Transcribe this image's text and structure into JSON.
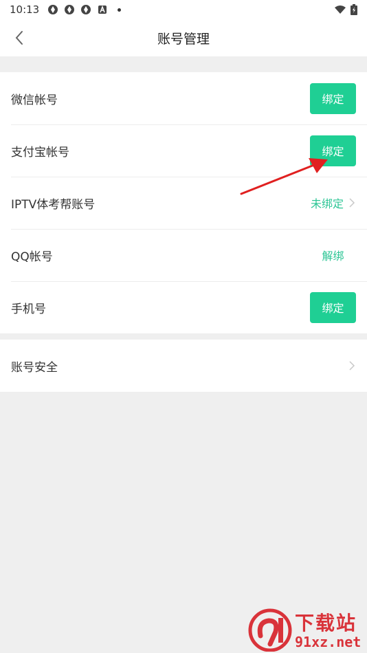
{
  "status_bar": {
    "time": "10:13",
    "icons": [
      "notification-icon",
      "notification-icon",
      "notification-icon",
      "a-icon",
      "dot-icon"
    ],
    "right_icons": [
      "wifi-icon",
      "battery-icon"
    ]
  },
  "header": {
    "title": "账号管理",
    "back_icon": "chevron-left-icon"
  },
  "accounts": [
    {
      "label": "微信帐号",
      "action": "绑定"
    },
    {
      "label": "支付宝帐号",
      "action": "绑定"
    },
    {
      "label": "IPTV体考帮账号",
      "status": "未绑定"
    },
    {
      "label": "QQ帐号",
      "action": "解绑"
    },
    {
      "label": "手机号",
      "action": "绑定"
    }
  ],
  "security": {
    "label": "账号安全"
  },
  "colors": {
    "accent": "#1fcf94",
    "accent_text": "#2cc595",
    "background": "#efefef",
    "arrow": "#e02020"
  },
  "watermark": {
    "top": "下载站",
    "bottom": "91xz.net"
  }
}
